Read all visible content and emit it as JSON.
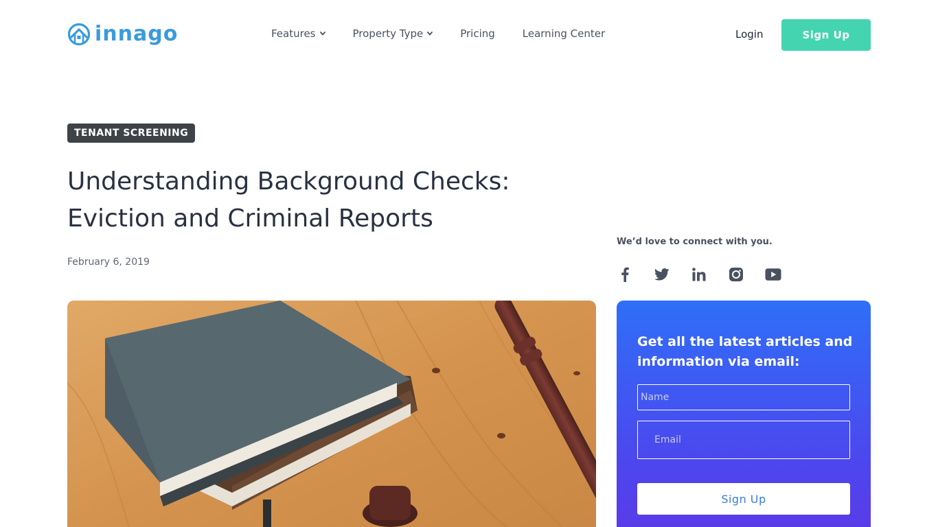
{
  "brand": {
    "name": "innago",
    "accent": "#3a9bdc",
    "icon": "house-circle-logo-icon"
  },
  "nav": {
    "items": [
      {
        "label": "Features",
        "has_dropdown": true
      },
      {
        "label": "Property Type",
        "has_dropdown": true
      },
      {
        "label": "Pricing",
        "has_dropdown": false
      },
      {
        "label": "Learning Center",
        "has_dropdown": false
      }
    ],
    "login_label": "Login",
    "signup_label": "Sign Up",
    "signup_color": "#44d4b0"
  },
  "article": {
    "category": "TENANT SCREENING",
    "title": "Understanding Background Checks: Eviction and Criminal Reports",
    "date": "February 6, 2019",
    "hero_image": "books-and-gavel-on-wooden-table"
  },
  "sidebar": {
    "connect_text": "We’d love to connect with you.",
    "social": [
      {
        "icon": "facebook-icon"
      },
      {
        "icon": "twitter-icon"
      },
      {
        "icon": "linkedin-icon"
      },
      {
        "icon": "instagram-icon"
      },
      {
        "icon": "youtube-icon"
      }
    ],
    "newsletter": {
      "heading": "Get all the latest articles and information via email:",
      "name_placeholder": "Name",
      "email_placeholder": "Email",
      "button_label": "Sign Up",
      "gradient_top": "#2f6ff7",
      "gradient_bottom": "#5a3be8"
    }
  }
}
